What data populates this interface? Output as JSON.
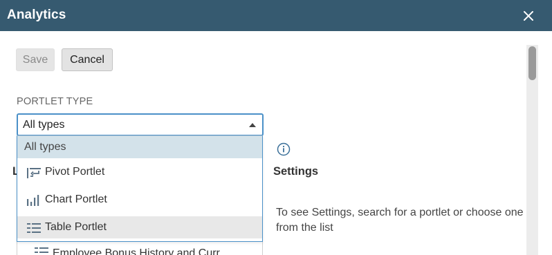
{
  "window": {
    "title": "Analytics"
  },
  "toolbar": {
    "save_label": "Save",
    "cancel_label": "Cancel"
  },
  "portlet_type": {
    "label": "PORTLET TYPE",
    "selected": "All types",
    "options": [
      {
        "label": "All types",
        "icon": "",
        "state": "selected"
      },
      {
        "label": "Pivot Portlet",
        "icon": "pivot-icon",
        "state": "normal"
      },
      {
        "label": "Chart Portlet",
        "icon": "bar-chart-icon",
        "state": "normal"
      },
      {
        "label": "Table Portlet",
        "icon": "table-icon",
        "state": "hover"
      }
    ]
  },
  "left_panel": {
    "heading_partial": "L",
    "partial_row": "Employee Bonus History and Curr"
  },
  "settings": {
    "heading": "Settings",
    "hint": "To see Settings, search for a portlet or choose one from the list"
  },
  "colors": {
    "titlebar": "#365a70",
    "focus_border": "#4a90c8",
    "selected_option": "#d3e2ea",
    "hover_option": "#e8e8e8"
  }
}
